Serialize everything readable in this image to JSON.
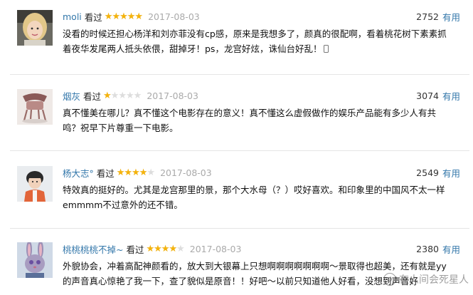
{
  "colors": {
    "link": "#3377aa",
    "star": "#f5b30b",
    "star_empty": "#dddddd",
    "date": "#aaaaaa"
  },
  "reviews": [
    {
      "user": "moli",
      "seen": "看过",
      "rating": 5,
      "date": "2017-08-03",
      "useful_count": "2752",
      "useful_label": "有用",
      "lines": [
        "没看的时候还担心杨洋和刘亦菲没有cp感，原来是我想多了，颜真的很配啊，看着桃花树下素素抓",
        "着夜华发尾两人抵头依偎，甜掉牙！ps，龙宫好炫，诛仙台好乱！"
      ],
      "avatar_icon": "avatar-blonde-girl",
      "trailing_icon": "phone-icon"
    },
    {
      "user": "烟灰",
      "seen": "看过",
      "rating": 1,
      "date": "2017-08-03",
      "useful_count": "3074",
      "useful_label": "有用",
      "lines": [
        "真不懂美在哪儿？真不懂这个电影存在的意义！真不懂这么虚假做作的娱乐产品能有多少人有共",
        "鸣？祝早下片尊重一下电影。"
      ],
      "avatar_icon": "avatar-chair"
    },
    {
      "user": "杨大志°",
      "seen": "看过",
      "rating": 4,
      "date": "2017-08-03",
      "useful_count": "2549",
      "useful_label": "有用",
      "lines": [
        "特效真的挺好的。尤其是龙宫那里的景，那个大水母（？）哎好喜欢。和印象里的中国风不太一样",
        "emmmm不过意外的还不错。"
      ],
      "avatar_icon": "avatar-boy"
    },
    {
      "user": "桃桃桃桃不掉~",
      "seen": "看过",
      "rating": 4,
      "date": "2017-08-03",
      "useful_count": "2380",
      "useful_label": "有用",
      "lines": [
        "外貌协会，冲着高配神颜看的，放大到大银幕上只想啊啊啊啊啊啊啊～景取得也超美，还有就是yy",
        "的声音真心惊艳了我一下，查了貌似是原音！！好吧～以前只知道他人好看，没想到声音好"
      ],
      "avatar_icon": "avatar-rabbit"
    }
  ],
  "watermark": {
    "text": "在人间会死星人",
    "icon": "wechat-icon"
  }
}
